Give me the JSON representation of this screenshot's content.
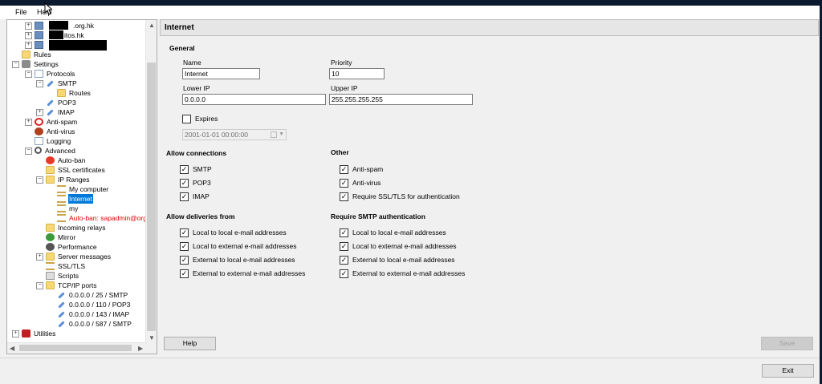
{
  "menu": {
    "file": "File",
    "help": "Help"
  },
  "tree": {
    "nodes": [
      {
        "text": ".org.hk"
      },
      {
        "text": "itos.hk"
      },
      {
        "text": ""
      },
      {
        "text": "Rules"
      },
      {
        "text": "Settings"
      },
      {
        "text": "Protocols"
      },
      {
        "text": "SMTP"
      },
      {
        "text": "Routes"
      },
      {
        "text": "POP3"
      },
      {
        "text": "IMAP"
      },
      {
        "text": "Anti-spam"
      },
      {
        "text": "Anti-virus"
      },
      {
        "text": "Logging"
      },
      {
        "text": "Advanced"
      },
      {
        "text": "Auto-ban"
      },
      {
        "text": "SSL certificates"
      },
      {
        "text": "IP Ranges"
      },
      {
        "text": "My computer"
      },
      {
        "text": "Internet"
      },
      {
        "text": "my"
      },
      {
        "text": "Auto-ban: sapadmin@org.h"
      },
      {
        "text": "Incoming relays"
      },
      {
        "text": "Mirror"
      },
      {
        "text": "Performance"
      },
      {
        "text": "Server messages"
      },
      {
        "text": "SSL/TLS"
      },
      {
        "text": "Scripts"
      },
      {
        "text": "TCP/IP ports"
      },
      {
        "text": "0.0.0.0 / 25 / SMTP"
      },
      {
        "text": "0.0.0.0 / 110 / POP3"
      },
      {
        "text": "0.0.0.0 / 143 / IMAP"
      },
      {
        "text": "0.0.0.0 / 587 / SMTP"
      },
      {
        "text": "Utilities"
      }
    ],
    "selected": "Internet",
    "scroll_up": "▲",
    "scroll_down": "▼",
    "scroll_left": "◀",
    "scroll_right": "▶"
  },
  "panel": {
    "title": "Internet",
    "general": {
      "heading": "General",
      "name_label": "Name",
      "name_value": "Internet",
      "priority_label": "Priority",
      "priority_value": "10",
      "lower_ip_label": "Lower IP",
      "lower_ip_value": "0.0.0.0",
      "upper_ip_label": "Upper IP",
      "upper_ip_value": "255.255.255.255",
      "expires_label": "Expires",
      "expires_checked": false,
      "expires_value": "2001-01-01 00:00:00"
    },
    "allow_connections": {
      "heading": "Allow connections",
      "items": [
        {
          "label": "SMTP",
          "checked": "✓"
        },
        {
          "label": "POP3",
          "checked": "✓"
        },
        {
          "label": "IMAP",
          "checked": "✓"
        }
      ]
    },
    "other": {
      "heading": "Other",
      "items": [
        {
          "label": "Anti-spam",
          "checked": "✓"
        },
        {
          "label": "Anti-virus",
          "checked": "✓"
        },
        {
          "label": "Require SSL/TLS for authentication",
          "checked": "✓"
        }
      ]
    },
    "allow_deliveries": {
      "heading": "Allow deliveries from",
      "items": [
        {
          "label": "Local to local e-mail addresses",
          "checked": "✓"
        },
        {
          "label": "Local to external e-mail addresses",
          "checked": "✓"
        },
        {
          "label": "External to local e-mail addresses",
          "checked": "✓"
        },
        {
          "label": "External to external e-mail addresses",
          "checked": "✓"
        }
      ]
    },
    "require_smtp_auth": {
      "heading": "Require SMTP authentication",
      "items": [
        {
          "label": "Local to local e-mail addresses",
          "checked": "✓"
        },
        {
          "label": "Local to external e-mail addresses",
          "checked": "✓"
        },
        {
          "label": "External to local e-mail addresses",
          "checked": "✓"
        },
        {
          "label": "External to external e-mail addresses",
          "checked": "✓"
        }
      ]
    }
  },
  "buttons": {
    "help": "Help",
    "save": "Save",
    "exit": "Exit"
  },
  "colors": {
    "selection": "#0078d7",
    "autoban_text": "#e00000",
    "background": "#f0f0f0"
  }
}
